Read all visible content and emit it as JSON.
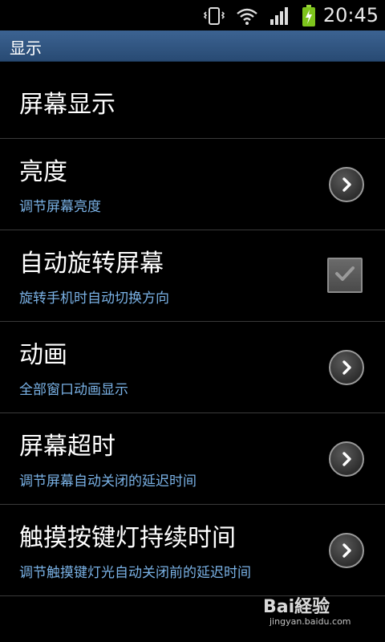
{
  "status_bar": {
    "time": "20:45",
    "icons": [
      "vibrate-icon",
      "wifi-icon",
      "signal-icon",
      "battery-charging-icon"
    ]
  },
  "title_bar": {
    "title": "显示"
  },
  "settings": {
    "header": "屏幕显示",
    "items": [
      {
        "title": "亮度",
        "subtitle": "调节屏幕亮度",
        "control": "chevron"
      },
      {
        "title": "自动旋转屏幕",
        "subtitle": "旋转手机时自动切换方向",
        "control": "checkbox",
        "checked": true
      },
      {
        "title": "动画",
        "subtitle": "全部窗口动画显示",
        "control": "chevron"
      },
      {
        "title": "屏幕超时",
        "subtitle": "调节屏幕自动关闭的延迟时间",
        "control": "chevron"
      },
      {
        "title": "触摸按键灯持续时间",
        "subtitle": "调节触摸键灯光自动关闭前的延迟时间",
        "control": "chevron"
      }
    ]
  },
  "watermark": {
    "brand": "Bai経验",
    "url": "jingyan.baidu.com"
  },
  "colors": {
    "title_bar": "#2f5583",
    "subtitle": "#7ab2e6",
    "background": "#000000"
  }
}
